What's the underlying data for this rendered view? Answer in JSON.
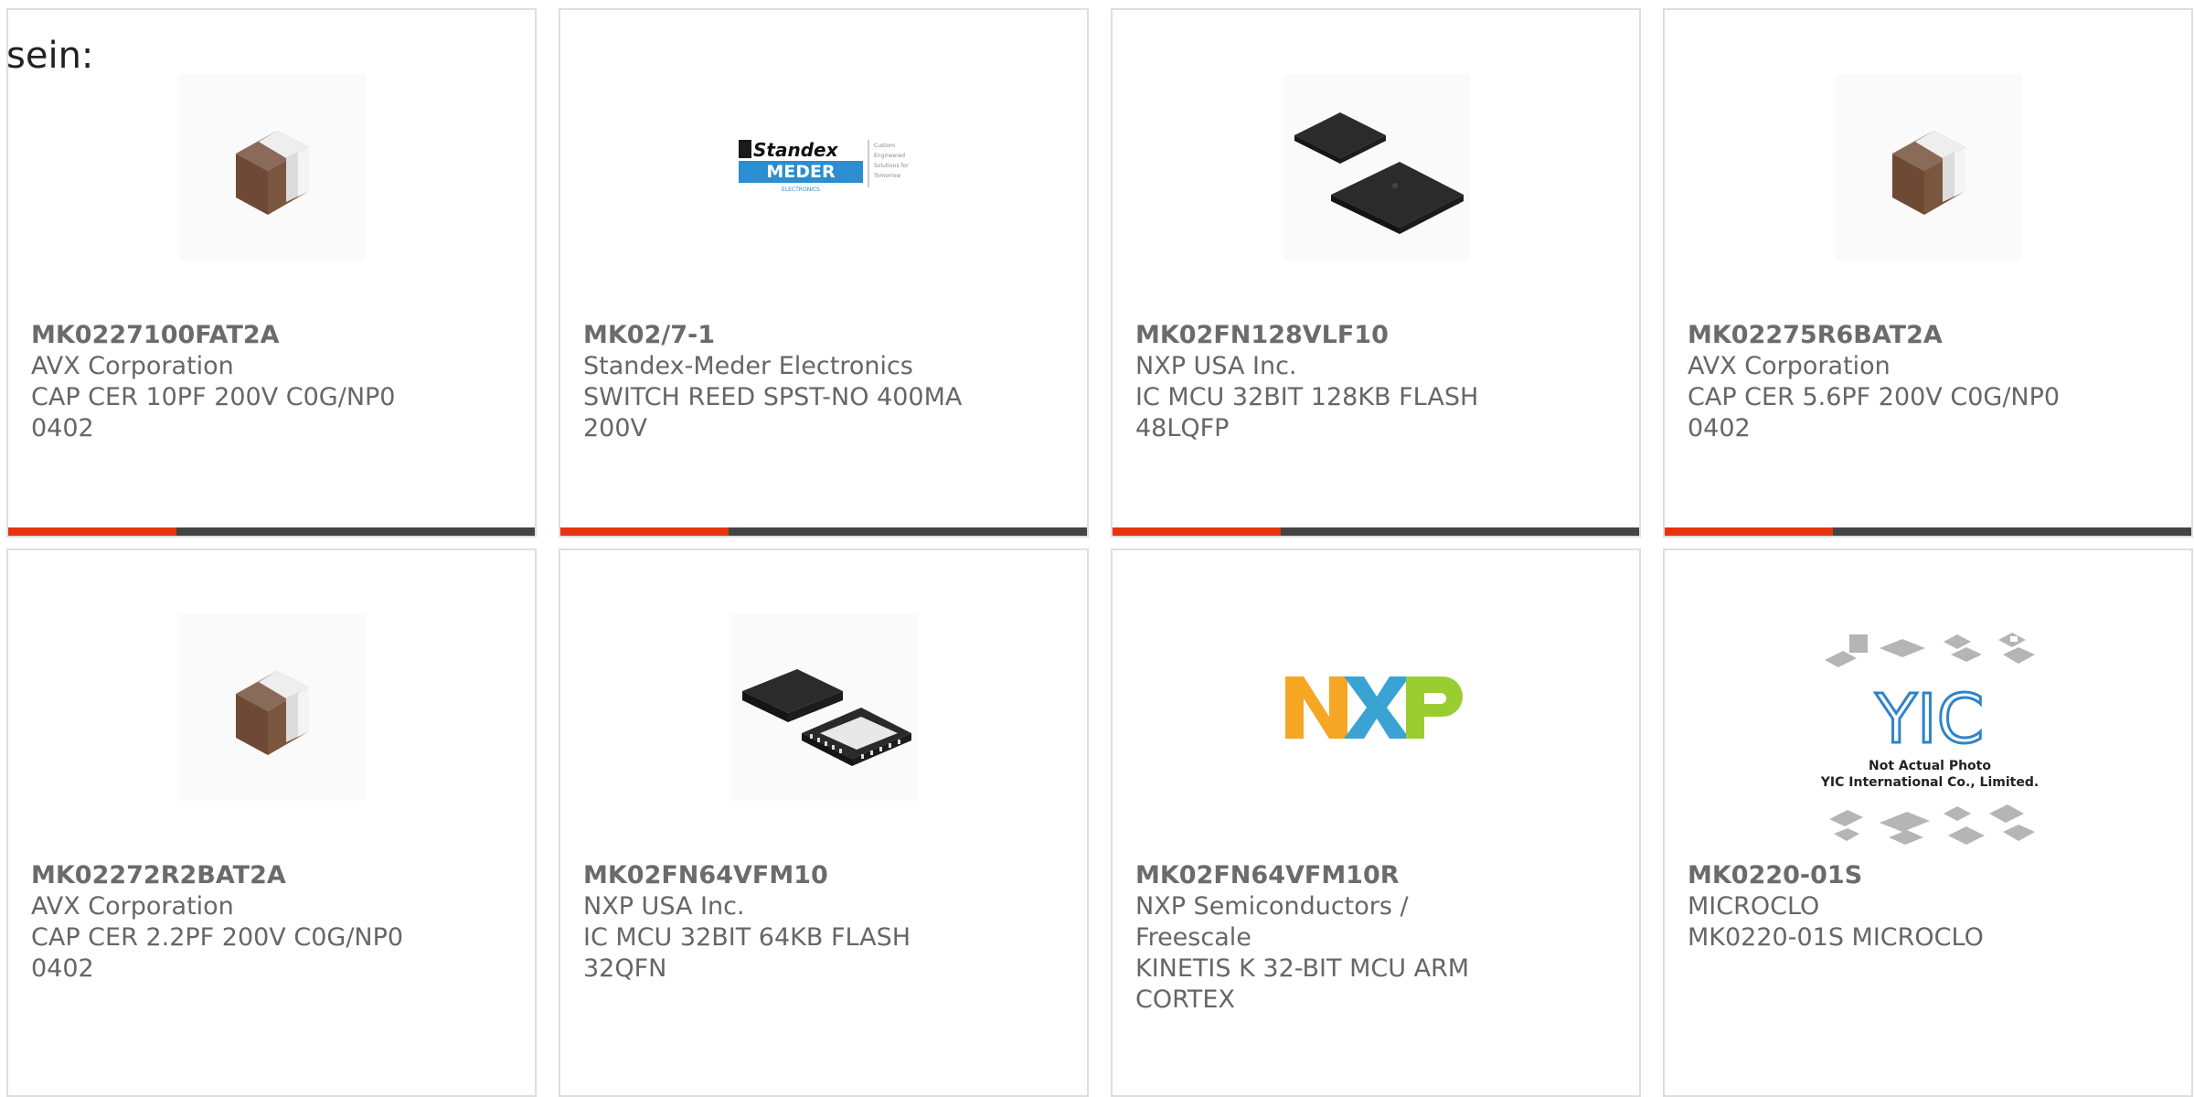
{
  "intro_text": "sein:",
  "colors": {
    "accent": "#e8340e",
    "bar": "#444444",
    "text": "#666666"
  },
  "products": [
    {
      "part": "MK0227100FAT2A",
      "maker": "AVX Corporation",
      "desc1": "CAP CER 10PF 200V C0G/NP0",
      "desc2": "0402",
      "image": "ceramic-capacitor-image"
    },
    {
      "part": "MK02/7-1",
      "maker": "Standex-Meder Electronics",
      "desc1": "SWITCH REED SPST-NO 400MA",
      "desc2": "200V",
      "image": "standex-meder-logo"
    },
    {
      "part": "MK02FN128VLF10",
      "maker": "NXP USA Inc.",
      "desc1": "IC MCU 32BIT 128KB FLASH",
      "desc2": "48LQFP",
      "image": "lqfp-chip-image"
    },
    {
      "part": "MK02275R6BAT2A",
      "maker": "AVX Corporation",
      "desc1": "CAP CER 5.6PF 200V C0G/NP0",
      "desc2": "0402",
      "image": "ceramic-capacitor-image"
    },
    {
      "part": "MK02272R2BAT2A",
      "maker": "AVX Corporation",
      "desc1": "CAP CER 2.2PF 200V C0G/NP0",
      "desc2": "0402",
      "image": "ceramic-capacitor-image"
    },
    {
      "part": "MK02FN64VFM10",
      "maker": "NXP USA Inc.",
      "desc1": "IC MCU 32BIT 64KB FLASH",
      "desc2": "32QFN",
      "image": "qfn-chip-image"
    },
    {
      "part": "MK02FN64VFM10R",
      "maker": "NXP Semiconductors / Freescale",
      "desc1": "KINETIS K 32-BIT MCU ARM",
      "desc2": "CORTEX",
      "image": "nxp-logo"
    },
    {
      "part": "MK0220-01S",
      "maker": "MICROCLO",
      "desc1": "MK0220-01S MICROCLO",
      "desc2": "",
      "image": "yic-placeholder-image"
    }
  ],
  "logos": {
    "standex_word": "Standex",
    "meder_word": "MEDER",
    "electronics_word": "ELECTRONICS",
    "standex_tagline": [
      "Custom",
      "Engineered",
      "Solutions for",
      "Tomorrow"
    ],
    "nxp_text": "NXP",
    "yic_mark": "YIC",
    "yic_line1": "Not Actual Photo",
    "yic_line2": "YIC International Co., Limited."
  }
}
